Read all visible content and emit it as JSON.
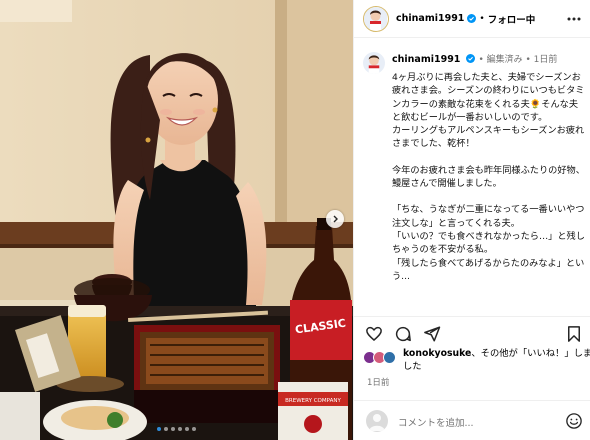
{
  "header": {
    "username": "chinami1991",
    "separator": "•",
    "follow_label": "フォロー中"
  },
  "caption": {
    "username": "chinami1991",
    "meta": "• 編集済み • 1日前",
    "paragraphs": [
      "4ヶ月ぶりに再会した夫と、夫婦でシーズンお疲れさま会。シーズンの終わりにいつもビタミンカラーの素敵な花束をくれる夫🌻そんな夫と飲むビールが一番おいしいのです。\nカーリングもアルペンスキーもシーズンお疲れさまでした、乾杯！",
      "今年のお疲れさま会も昨年同様ふたりの好物、鰻屋さんで開催しました。",
      "「ちな、うなぎが二重になってる一番いいやつ注文しな」と言ってくれる夫。\n「いいの？でも食べきれなかったら…」と残しちゃうのを不安がる私。\n「残したら食べてあげるからたのみなよ」という..."
    ]
  },
  "likes": {
    "user": "konokyosuke",
    "text": "、その他が「いいね！」しました"
  },
  "timestamp": "1日前",
  "comment": {
    "placeholder": "コメントを追加..."
  },
  "photo": {
    "bottle_label": "CLASSIC",
    "can_label": "BREWERY COMPANY",
    "slide_count": 6,
    "active_slide": 1
  },
  "colors": {
    "verified": "#0095f6",
    "carousel_active": "#2e8bd8",
    "secondary_text": "#737373"
  }
}
